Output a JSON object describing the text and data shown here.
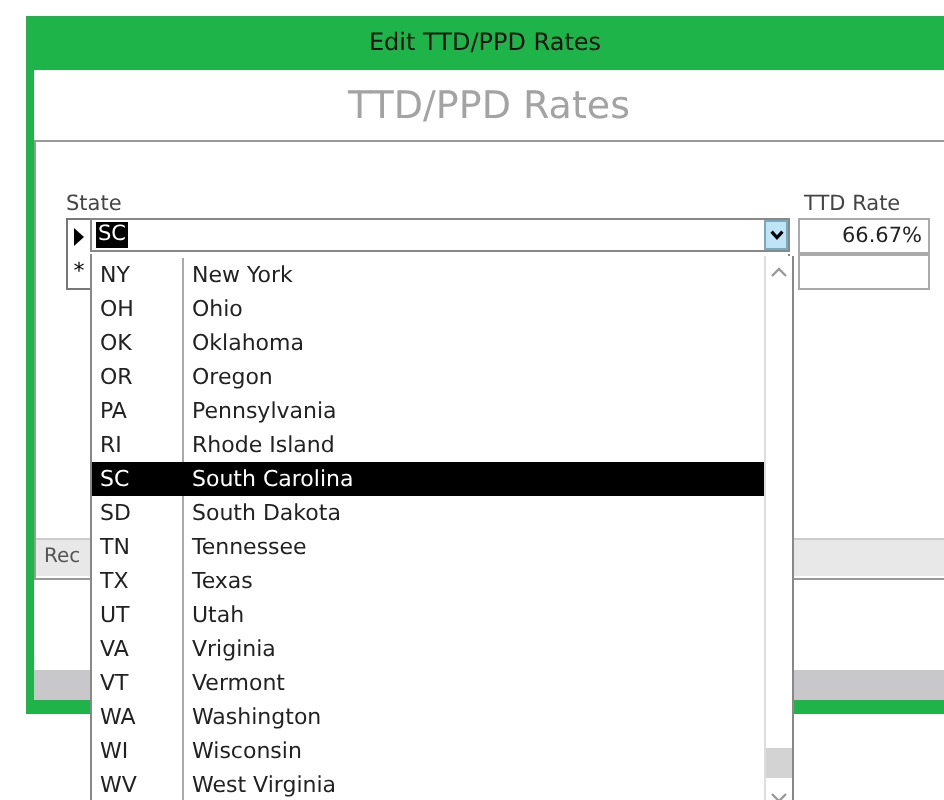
{
  "window": {
    "title": "Edit TTD/PPD Rates"
  },
  "heading": "TTD/PPD Rates",
  "subform": {
    "columns": [
      "State",
      "TTD Rate"
    ],
    "rows": [
      {
        "kind": "current",
        "state": "SC",
        "rate": "66.67%"
      },
      {
        "kind": "new",
        "marker": "*"
      }
    ],
    "navigation": "Rec"
  },
  "dropdown": {
    "items": [
      {
        "code": "NY",
        "name": "New York",
        "selected": false
      },
      {
        "code": "OH",
        "name": "Ohio",
        "selected": false
      },
      {
        "code": "OK",
        "name": "Oklahoma",
        "selected": false
      },
      {
        "code": "OR",
        "name": "Oregon",
        "selected": false
      },
      {
        "code": "PA",
        "name": "Pennsylvania",
        "selected": false
      },
      {
        "code": "RI",
        "name": "Rhode Island",
        "selected": false
      },
      {
        "code": "SC",
        "name": "South Carolina",
        "selected": true
      },
      {
        "code": "SD",
        "name": "South Dakota",
        "selected": false
      },
      {
        "code": "TN",
        "name": "Tennessee",
        "selected": false
      },
      {
        "code": "TX",
        "name": "Texas",
        "selected": false
      },
      {
        "code": "UT",
        "name": "Utah",
        "selected": false
      },
      {
        "code": "VA",
        "name": "Vriginia",
        "selected": false
      },
      {
        "code": "VT",
        "name": "Vermont",
        "selected": false
      },
      {
        "code": "WA",
        "name": "Washington",
        "selected": false
      },
      {
        "code": "WI",
        "name": "Wisconsin",
        "selected": false
      },
      {
        "code": "WV",
        "name": "West Virginia",
        "selected": false
      }
    ]
  }
}
